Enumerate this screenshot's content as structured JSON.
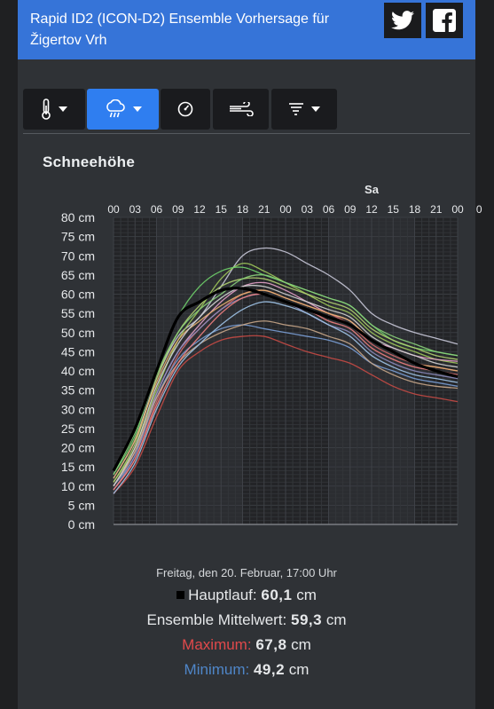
{
  "header": {
    "title": "Rapid ID2 (ICON-D2) Ensemble Vorhersage für Žigertov Vrh",
    "twitter_icon": "twitter-icon",
    "facebook_icon": "facebook-icon"
  },
  "toolbar": {
    "buttons": [
      {
        "icon": "thermometer-icon",
        "active": false
      },
      {
        "icon": "cloud-rain-icon",
        "active": true
      },
      {
        "icon": "gauge-icon",
        "active": false
      },
      {
        "icon": "wind-icon",
        "active": false
      },
      {
        "icon": "tornado-icon",
        "active": false
      }
    ]
  },
  "chart": {
    "title": "Schneehöhe"
  },
  "chart_data": {
    "type": "line",
    "title": "Schneehöhe",
    "x_day_label": "Sa",
    "x_ticks": [
      "00",
      "03",
      "06",
      "09",
      "12",
      "15",
      "18",
      "21",
      "00",
      "03",
      "06",
      "09",
      "12",
      "15",
      "18",
      "21",
      "00",
      "0"
    ],
    "y_ticks": [
      "80 cm",
      "75 cm",
      "70 cm",
      "65 cm",
      "60 cm",
      "55 cm",
      "50 cm",
      "45 cm",
      "40 cm",
      "35 cm",
      "30 cm",
      "25 cm",
      "20 cm",
      "15 cm",
      "10 cm",
      "5 cm",
      "0 cm"
    ],
    "ylim": [
      0,
      80
    ],
    "xlim_hours": [
      0,
      48
    ],
    "series": [
      {
        "values": [
          [
            0,
            14
          ],
          [
            3,
            25
          ],
          [
            6,
            40
          ],
          [
            9,
            54
          ],
          [
            12,
            58
          ],
          [
            15,
            61
          ],
          [
            18,
            61.5
          ],
          [
            21,
            60
          ],
          [
            24,
            58
          ],
          [
            27,
            56
          ],
          [
            30,
            54
          ],
          [
            33,
            52
          ],
          [
            36,
            48
          ],
          [
            39,
            45
          ],
          [
            42,
            42
          ],
          [
            45,
            40
          ],
          [
            48,
            38.5
          ]
        ],
        "color": "#000000",
        "main": true
      },
      {
        "values": [
          [
            0,
            12
          ],
          [
            3,
            22
          ],
          [
            6,
            38
          ],
          [
            9,
            49
          ],
          [
            12,
            54
          ],
          [
            15,
            62
          ],
          [
            18,
            70
          ],
          [
            21,
            72
          ],
          [
            24,
            71
          ],
          [
            27,
            68
          ],
          [
            30,
            65
          ],
          [
            33,
            61
          ],
          [
            36,
            55
          ],
          [
            39,
            52
          ],
          [
            42,
            50
          ],
          [
            45,
            48.5
          ],
          [
            48,
            47
          ]
        ],
        "color": "#c8c8d8"
      },
      {
        "values": [
          [
            0,
            11
          ],
          [
            3,
            20
          ],
          [
            6,
            35
          ],
          [
            9,
            48
          ],
          [
            12,
            56
          ],
          [
            15,
            64
          ],
          [
            18,
            68
          ],
          [
            21,
            66
          ],
          [
            24,
            63
          ],
          [
            27,
            60
          ],
          [
            30,
            57
          ],
          [
            33,
            55
          ],
          [
            36,
            50
          ],
          [
            39,
            47
          ],
          [
            42,
            45
          ],
          [
            45,
            43
          ],
          [
            48,
            42
          ]
        ],
        "color": "#9fc85a"
      },
      {
        "values": [
          [
            0,
            13
          ],
          [
            3,
            23
          ],
          [
            6,
            40
          ],
          [
            9,
            54
          ],
          [
            12,
            62
          ],
          [
            15,
            66
          ],
          [
            18,
            67
          ],
          [
            21,
            65
          ],
          [
            24,
            63
          ],
          [
            27,
            61
          ],
          [
            30,
            59
          ],
          [
            33,
            57
          ],
          [
            36,
            52
          ],
          [
            39,
            48
          ],
          [
            42,
            46
          ],
          [
            45,
            45
          ],
          [
            48,
            44
          ]
        ],
        "color": "#6fd06a"
      },
      {
        "values": [
          [
            0,
            10
          ],
          [
            3,
            19
          ],
          [
            6,
            34
          ],
          [
            9,
            45
          ],
          [
            12,
            52
          ],
          [
            15,
            58
          ],
          [
            18,
            62
          ],
          [
            21,
            63
          ],
          [
            24,
            61
          ],
          [
            27,
            58
          ],
          [
            30,
            55
          ],
          [
            33,
            53
          ],
          [
            36,
            48
          ],
          [
            39,
            46
          ],
          [
            42,
            44
          ],
          [
            45,
            43
          ],
          [
            48,
            42.5
          ]
        ],
        "color": "#e3a0c8"
      },
      {
        "values": [
          [
            0,
            9
          ],
          [
            3,
            17
          ],
          [
            6,
            32
          ],
          [
            9,
            44
          ],
          [
            12,
            51
          ],
          [
            15,
            56
          ],
          [
            18,
            60
          ],
          [
            21,
            61
          ],
          [
            24,
            59
          ],
          [
            27,
            57
          ],
          [
            30,
            55
          ],
          [
            33,
            52
          ],
          [
            36,
            47
          ],
          [
            39,
            44
          ],
          [
            42,
            42
          ],
          [
            45,
            41
          ],
          [
            48,
            40
          ]
        ],
        "color": "#d46a6a"
      },
      {
        "values": [
          [
            0,
            8
          ],
          [
            3,
            15
          ],
          [
            6,
            28
          ],
          [
            9,
            40
          ],
          [
            12,
            45
          ],
          [
            15,
            48
          ],
          [
            18,
            49
          ],
          [
            21,
            49
          ],
          [
            24,
            47
          ],
          [
            27,
            45
          ],
          [
            30,
            43.5
          ],
          [
            33,
            42
          ],
          [
            36,
            39
          ],
          [
            39,
            36
          ],
          [
            42,
            34
          ],
          [
            45,
            33
          ],
          [
            48,
            32
          ]
        ],
        "color": "#c74a45"
      },
      {
        "values": [
          [
            0,
            10
          ],
          [
            3,
            18
          ],
          [
            6,
            33
          ],
          [
            9,
            43
          ],
          [
            12,
            48
          ],
          [
            15,
            51
          ],
          [
            18,
            52
          ],
          [
            21,
            51
          ],
          [
            24,
            50
          ],
          [
            27,
            49
          ],
          [
            30,
            48
          ],
          [
            33,
            46
          ],
          [
            36,
            42
          ],
          [
            39,
            40
          ],
          [
            42,
            38
          ],
          [
            45,
            37
          ],
          [
            48,
            36
          ]
        ],
        "color": "#7a9fd6"
      },
      {
        "values": [
          [
            0,
            9
          ],
          [
            3,
            18
          ],
          [
            6,
            34
          ],
          [
            9,
            45
          ],
          [
            12,
            51
          ],
          [
            15,
            56
          ],
          [
            18,
            59
          ],
          [
            21,
            60
          ],
          [
            24,
            58
          ],
          [
            27,
            55
          ],
          [
            30,
            52
          ],
          [
            33,
            50
          ],
          [
            36,
            45
          ],
          [
            39,
            42
          ],
          [
            42,
            40
          ],
          [
            45,
            39
          ],
          [
            48,
            38
          ]
        ],
        "color": "#8b8bbd"
      },
      {
        "values": [
          [
            0,
            11
          ],
          [
            3,
            21
          ],
          [
            6,
            38
          ],
          [
            9,
            50
          ],
          [
            12,
            57
          ],
          [
            15,
            62
          ],
          [
            18,
            64
          ],
          [
            21,
            64
          ],
          [
            24,
            62
          ],
          [
            27,
            60
          ],
          [
            30,
            58
          ],
          [
            33,
            56
          ],
          [
            36,
            51
          ],
          [
            39,
            48
          ],
          [
            42,
            46
          ],
          [
            45,
            44
          ],
          [
            48,
            43
          ]
        ],
        "color": "#b0d070"
      },
      {
        "values": [
          [
            0,
            12
          ],
          [
            3,
            22
          ],
          [
            6,
            37
          ],
          [
            9,
            48
          ],
          [
            12,
            53
          ],
          [
            15,
            57
          ],
          [
            18,
            60
          ],
          [
            21,
            61
          ],
          [
            24,
            59
          ],
          [
            27,
            57
          ],
          [
            30,
            55
          ],
          [
            33,
            53
          ],
          [
            36,
            48
          ],
          [
            39,
            45
          ],
          [
            42,
            42
          ],
          [
            45,
            41
          ],
          [
            48,
            40
          ]
        ],
        "color": "#e7b070"
      },
      {
        "values": [
          [
            0,
            10
          ],
          [
            3,
            19
          ],
          [
            6,
            33
          ],
          [
            9,
            42
          ],
          [
            12,
            47
          ],
          [
            15,
            50
          ],
          [
            18,
            52
          ],
          [
            21,
            53
          ],
          [
            24,
            52
          ],
          [
            27,
            51
          ],
          [
            30,
            49
          ],
          [
            33,
            47
          ],
          [
            36,
            42
          ],
          [
            39,
            39
          ],
          [
            42,
            37
          ],
          [
            45,
            36
          ],
          [
            48,
            35.5
          ]
        ],
        "color": "#c9a78a"
      },
      {
        "values": [
          [
            0,
            13
          ],
          [
            3,
            24
          ],
          [
            6,
            39
          ],
          [
            9,
            50
          ],
          [
            12,
            56
          ],
          [
            15,
            60
          ],
          [
            18,
            64
          ],
          [
            21,
            65
          ],
          [
            24,
            63
          ],
          [
            27,
            61
          ],
          [
            30,
            59
          ],
          [
            33,
            57
          ],
          [
            36,
            52
          ],
          [
            39,
            49
          ],
          [
            42,
            47
          ],
          [
            45,
            45
          ],
          [
            48,
            44
          ]
        ],
        "color": "#8ad07a"
      },
      {
        "values": [
          [
            0,
            9
          ],
          [
            3,
            17
          ],
          [
            6,
            31
          ],
          [
            9,
            42
          ],
          [
            12,
            49
          ],
          [
            15,
            55
          ],
          [
            18,
            59
          ],
          [
            21,
            60
          ],
          [
            24,
            58
          ],
          [
            27,
            56
          ],
          [
            30,
            53
          ],
          [
            33,
            51
          ],
          [
            36,
            46
          ],
          [
            39,
            43
          ],
          [
            42,
            41
          ],
          [
            45,
            40
          ],
          [
            48,
            39
          ]
        ],
        "color": "#f08080"
      },
      {
        "values": [
          [
            0,
            8
          ],
          [
            3,
            16
          ],
          [
            6,
            30
          ],
          [
            9,
            41
          ],
          [
            12,
            47
          ],
          [
            15,
            52
          ],
          [
            18,
            56
          ],
          [
            21,
            58
          ],
          [
            24,
            57
          ],
          [
            27,
            55
          ],
          [
            30,
            52
          ],
          [
            33,
            49
          ],
          [
            36,
            44
          ],
          [
            39,
            41
          ],
          [
            42,
            39
          ],
          [
            45,
            38
          ],
          [
            48,
            37
          ]
        ],
        "color": "#a0c4e8"
      },
      {
        "values": [
          [
            0,
            10
          ],
          [
            3,
            20
          ],
          [
            6,
            36
          ],
          [
            9,
            47
          ],
          [
            12,
            54
          ],
          [
            15,
            59
          ],
          [
            18,
            62
          ],
          [
            21,
            62
          ],
          [
            24,
            60
          ],
          [
            27,
            58
          ],
          [
            30,
            56
          ],
          [
            33,
            54
          ],
          [
            36,
            49
          ],
          [
            39,
            46
          ],
          [
            42,
            44
          ],
          [
            45,
            42
          ],
          [
            48,
            41
          ]
        ],
        "color": "#d3d3d3"
      }
    ],
    "readout": {
      "date_text": "Freitag, den 20. Februar, 17:00 Uhr",
      "main_label": "Hauptlauf:",
      "main_value": "60,1",
      "mean_label": "Ensemble Mittelwert:",
      "mean_value": "59,3",
      "max_label": "Maximum:",
      "max_value": "67,8",
      "min_label": "Minimum:",
      "min_value": "49,2",
      "unit": "cm"
    }
  }
}
